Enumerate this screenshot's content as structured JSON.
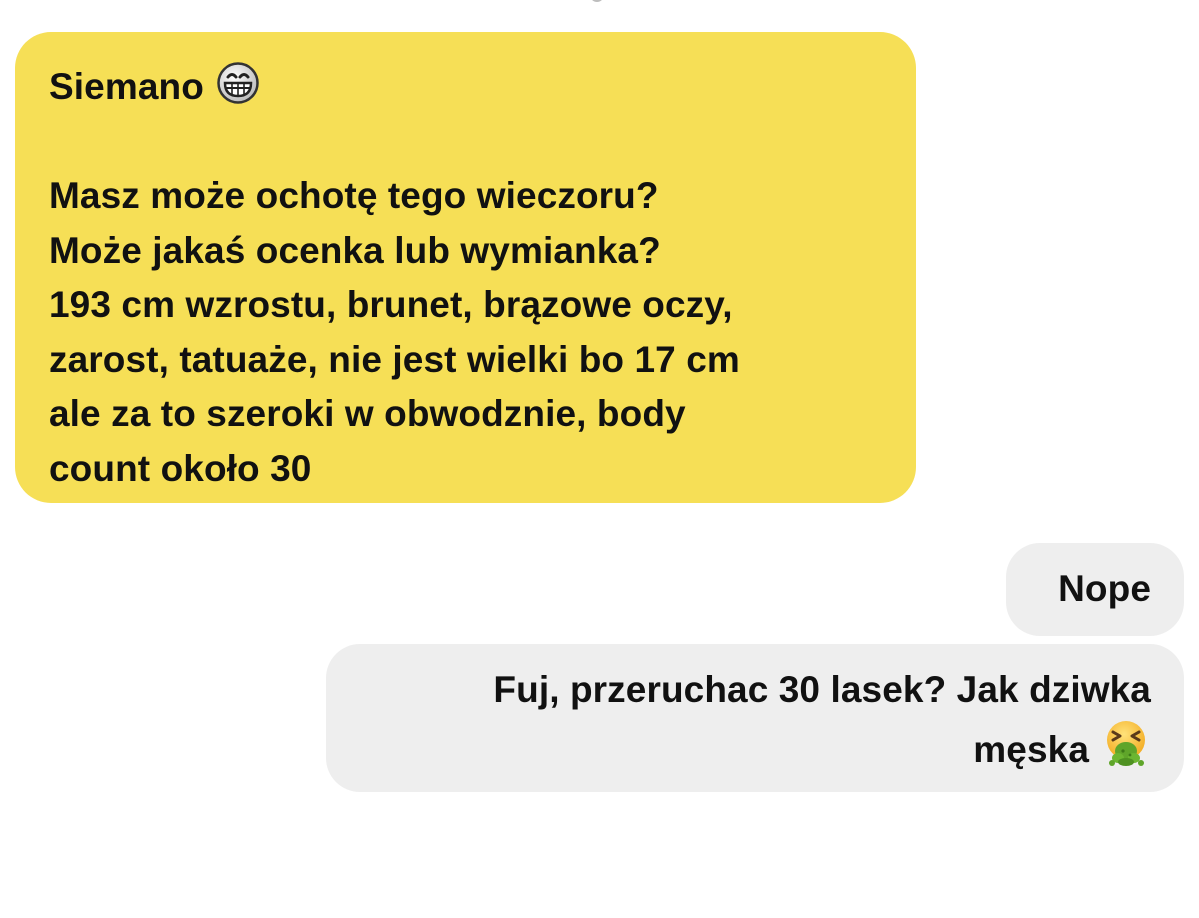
{
  "conversation": {
    "incoming": {
      "greeting": "Siemano",
      "greeting_emoji": "grinning-face-icon",
      "lines": [
        "Masz może ochotę tego wieczoru?",
        "Może jakaś ocenka lub wymianka?",
        "193 cm wzrostu, brunet, brązowe oczy,",
        "zarost, tatuaże, nie jest wielki bo 17 cm",
        "ale za to szeroki w obwodznie, body",
        "count około 30"
      ],
      "bubble_color": "#f6df56"
    },
    "outgoing": [
      {
        "lines": [
          "Nope"
        ],
        "bubble_color": "#eeeeee"
      },
      {
        "lines": [
          "Fuj, przeruchac 30 lasek? Jak dziwka",
          "męska"
        ],
        "trailing_emoji": "vomiting-face-icon",
        "bubble_color": "#eeeeee"
      }
    ]
  }
}
